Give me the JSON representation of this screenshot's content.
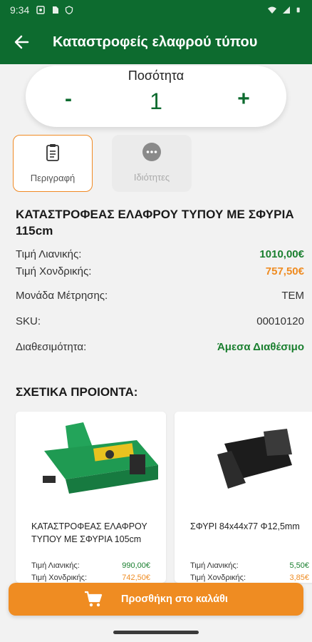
{
  "status_bar": {
    "time": "9:34"
  },
  "app_bar": {
    "title": "Καταστροφείς ελαφρού τύπου"
  },
  "quantity": {
    "label": "Ποσότητα",
    "minus": "-",
    "value": "1",
    "plus": "+"
  },
  "tabs": [
    {
      "label": "Περιγραφή",
      "icon": "clipboard-icon",
      "selected": true
    },
    {
      "label": "Ιδιότητες",
      "icon": "more-horizontal-icon",
      "selected": false
    }
  ],
  "product": {
    "title": "ΚΑΤΑΣΤΡΟΦΕΑΣ ΕΛΑΦΡΟΥ ΤΥΠΟΥ ΜΕ ΣΦΥΡΙΑ 115cm",
    "rows": [
      {
        "label": "Τιμή Λιανικής:",
        "value": "1010,00€"
      },
      {
        "label": "Τιμή Χονδρικής:",
        "value": "757,50€"
      },
      {
        "label": "Μονάδα Μέτρησης:",
        "value": "ΤΕΜ"
      },
      {
        "label": "SKU:",
        "value": "00010120"
      },
      {
        "label": "Διαθεσιμότητα:",
        "value": "Άμεσα Διαθέσιμο"
      }
    ]
  },
  "related": {
    "heading": "ΣΧΕΤΙΚΑ ΠΡΟΙΟΝΤΑ:",
    "items": [
      {
        "name": "ΚΑΤΑΣΤΡΟΦΕΑΣ ΕΛΑΦΡΟΥ ΤΥΠΟΥ ΜΕ ΣΦΥΡΙΑ 105cm",
        "retail_label": "Τιμή Λιανικής:",
        "retail": "990,00€",
        "wholesale_label": "Τιμή Χονδρικής:",
        "wholesale": "742,50€"
      },
      {
        "name": "ΣΦΥΡΙ 84x44x77 Φ12,5mm",
        "retail_label": "Τιμή Λιανικής:",
        "retail": "5,50€",
        "wholesale_label": "Τιμή Χονδρικής:",
        "wholesale": "3,85€"
      }
    ]
  },
  "cart_button": {
    "label": "Προσθήκη στο καλάθι"
  },
  "colors": {
    "primary": "#0d6b2f",
    "accent": "#ef8c22",
    "price_green": "#1a7f2f"
  }
}
